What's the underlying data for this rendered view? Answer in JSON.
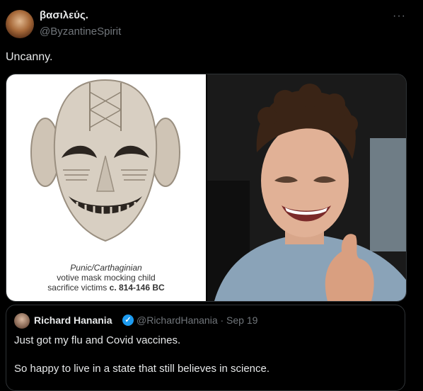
{
  "tweet": {
    "display_name": "βασιλεύς.",
    "handle": "@ByzantineSpirit",
    "text": "Uncanny.",
    "more_icon": "more-horizontal-icon"
  },
  "media": {
    "caption_line1": "Punic/Carthaginian",
    "caption_line2": "votive mask mocking child",
    "caption_line3a": "sacrifice victims ",
    "caption_line3b": "c. 814-146 BC"
  },
  "quote": {
    "display_name": "Richard Hanania",
    "handle_date": "@RichardHanania · Sep 19",
    "line1": "Just got my flu and Covid vaccines.",
    "line2": "So happy to live in a state that still believes in science.",
    "verified_icon": "verified-badge-icon"
  }
}
